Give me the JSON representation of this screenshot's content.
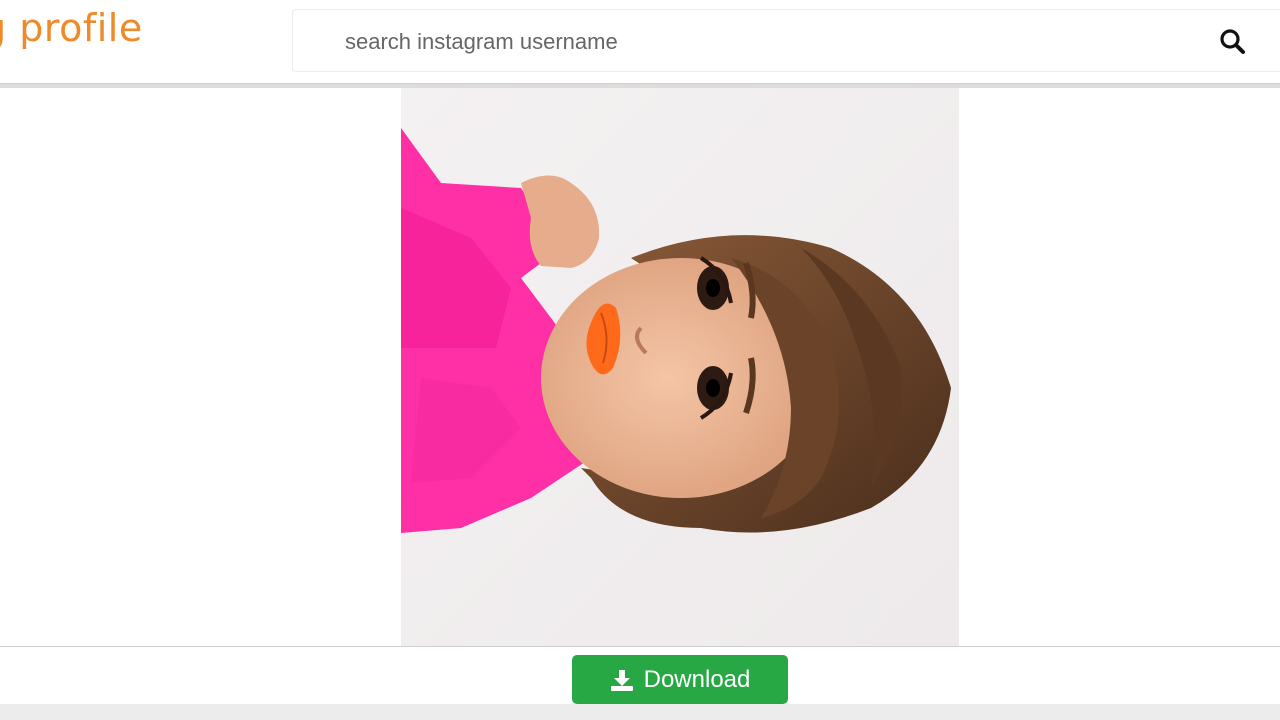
{
  "header": {
    "logo_text": "g profile",
    "search": {
      "placeholder": "search instagram username",
      "value": "",
      "icon": "search-icon"
    }
  },
  "main": {
    "photo": {
      "description_icon": "profile-photo"
    }
  },
  "actions": {
    "download_label": "Download",
    "download_icon": "download-icon",
    "download_color": "#28a745"
  },
  "colors": {
    "logo": "#ee8a2a",
    "sweater": "#ff2fa6",
    "lips": "#ff6a1a"
  }
}
